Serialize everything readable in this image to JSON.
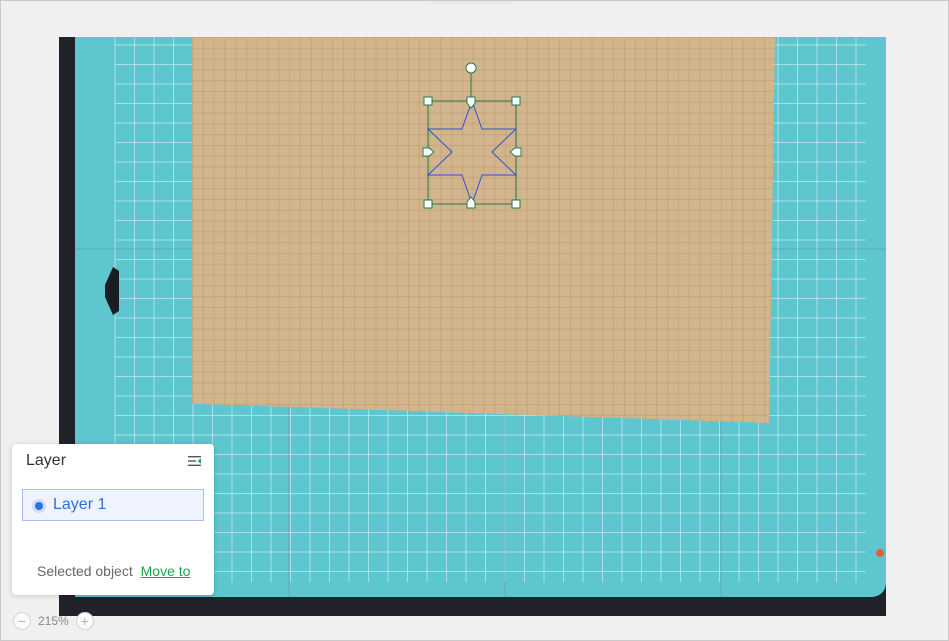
{
  "layer_panel": {
    "title": "Layer",
    "layers": [
      {
        "name": "Layer 1",
        "active": true
      }
    ],
    "selected_object_label": "Selected object",
    "move_to_label": "Move to",
    "menu_icon": "list-collapse-icon"
  },
  "zoom": {
    "level": "215%",
    "minus_icon": "minus-icon",
    "plus_icon": "plus-icon"
  },
  "colors": {
    "mat": "#5ec6cf",
    "cardboard": "#d3b58c",
    "selection_frame": "#1f7a4a",
    "shape_stroke": "#3050d8",
    "active_layer": "#2f6fe0",
    "link": "#17a84a"
  }
}
